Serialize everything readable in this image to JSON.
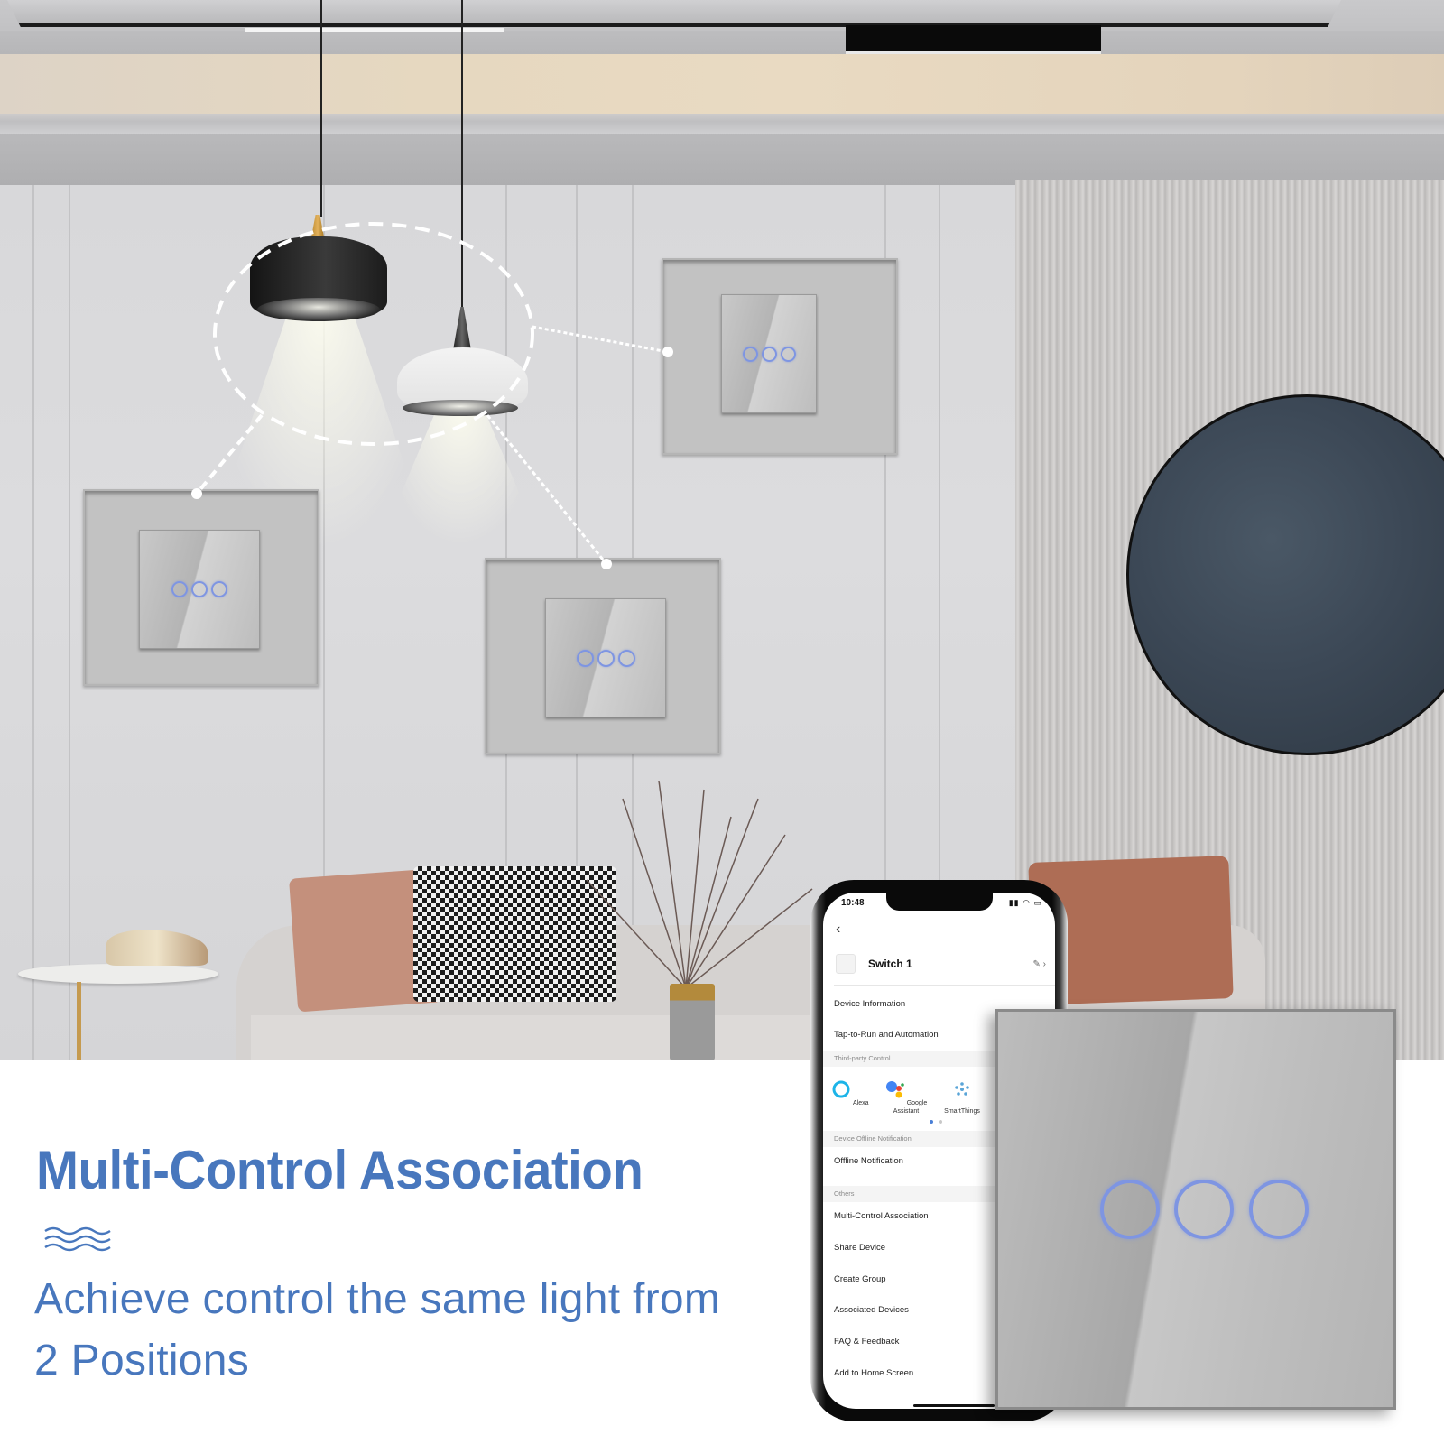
{
  "headline": "Multi-Control Association",
  "subtext_lines": [
    "Achieve control the same light from",
    "2 Positions"
  ],
  "decor_icon": "wave-lines-icon",
  "colors": {
    "accent_blue": "#4877bd",
    "switch_ring_blue": "#7e95e2",
    "switch_grey": "#bdbdbd"
  },
  "scene": {
    "pendant_lamps": 2,
    "wall_switches": [
      {
        "position": "upper-right",
        "gang_count": 3
      },
      {
        "position": "left",
        "gang_count": 3
      },
      {
        "position": "center",
        "gang_count": 3
      }
    ],
    "foreground_switch_gang_count": 3
  },
  "phone": {
    "status_time": "10:48",
    "status_icons": "signal wifi battery",
    "back_icon": "‹",
    "device_name": "Switch 1",
    "edit_icon": "✎ ›",
    "menu_top": [
      "Device Information",
      "Tap-to-Run and Automation"
    ],
    "third_party_label": "Third-party Control",
    "third_party": [
      {
        "name": "Alexa",
        "icon": "alexa-icon"
      },
      {
        "name": "Google Assistant",
        "icon": "google-assistant-icon"
      },
      {
        "name": "SmartThings",
        "icon": "smartthings-icon"
      }
    ],
    "pager": {
      "pages": 2,
      "active": 1
    },
    "offline_label": "Device Offline Notification",
    "offline_item": "Offline Notification",
    "others_label": "Others",
    "others_items": [
      "Multi-Control Association",
      "Share Device",
      "Create Group",
      "Associated Devices",
      "FAQ & Feedback",
      "Add to Home Screen"
    ]
  }
}
